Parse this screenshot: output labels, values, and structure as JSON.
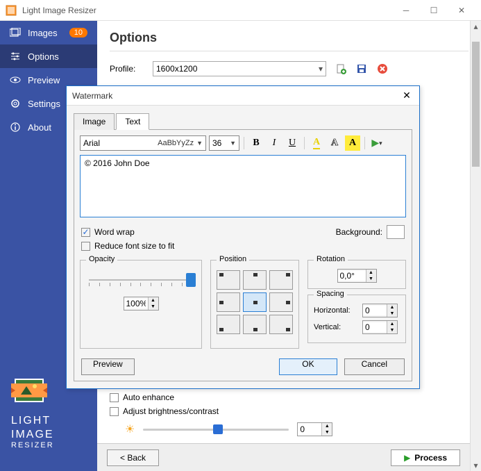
{
  "app": {
    "title": "Light Image Resizer"
  },
  "sidebar": {
    "items": [
      {
        "label": "Images",
        "badge": "10"
      },
      {
        "label": "Options"
      },
      {
        "label": "Preview"
      },
      {
        "label": "Settings"
      },
      {
        "label": "About"
      }
    ],
    "logo": {
      "line1": "LIGHT",
      "line2": "IMAGE",
      "line3": "RESIZER"
    }
  },
  "main": {
    "heading": "Options",
    "profile_label": "Profile:",
    "profile_value": "1600x1200",
    "auto_enhance": "Auto enhance",
    "adjust_bc": "Adjust brightness/contrast",
    "brightness_value": "0",
    "back_btn": "< Back",
    "process_btn": "Process"
  },
  "dialog": {
    "title": "Watermark",
    "tabs": {
      "image": "Image",
      "text": "Text"
    },
    "font_name": "Arial",
    "font_preview": "AaBbYyZz",
    "font_size": "36",
    "text_value": "© 2016 John Doe",
    "word_wrap": "Word wrap",
    "reduce_font": "Reduce font size to fit",
    "background_label": "Background:",
    "opacity": {
      "title": "Opacity",
      "value": "100%"
    },
    "position": {
      "title": "Position"
    },
    "rotation": {
      "title": "Rotation",
      "value": "0,0°"
    },
    "spacing": {
      "title": "Spacing",
      "horizontal_label": "Horizontal:",
      "horizontal": "0",
      "vertical_label": "Vertical:",
      "vertical": "0"
    },
    "preview_btn": "Preview",
    "ok_btn": "OK",
    "cancel_btn": "Cancel"
  }
}
